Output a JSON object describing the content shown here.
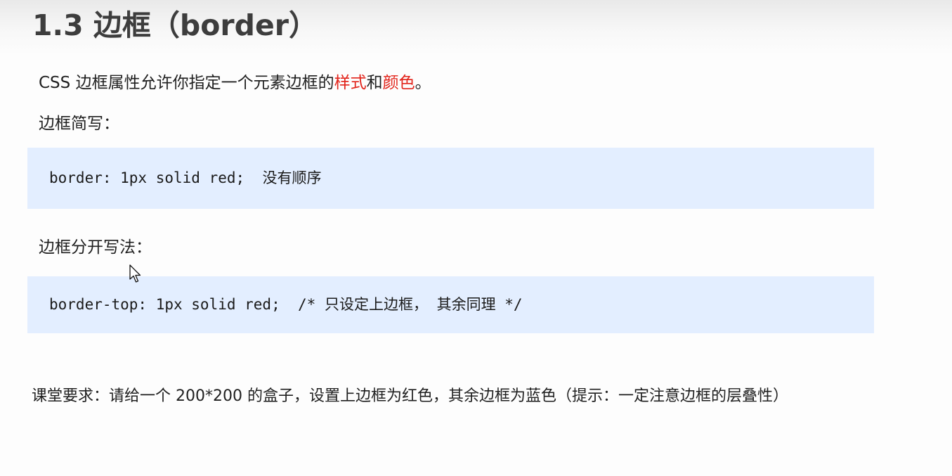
{
  "slide": {
    "title": "1.3 边框（border）"
  },
  "intro": {
    "before": "CSS 边框属性允许你指定一个元素边框的",
    "style_word": "样式",
    "and_word": "和",
    "color_word": "颜色",
    "end_punct": "。"
  },
  "shorthand": {
    "label": "边框简写：",
    "code": "border: 1px solid red;",
    "note": "没有顺序"
  },
  "separate": {
    "label": "边框分开写法：",
    "code": "border-top: 1px solid red;",
    "comment": "/* 只设定上边框， 其余同理 */"
  },
  "assignment": {
    "text": "课堂要求：请给一个 200*200 的盒子，设置上边框为红色，其余边框为蓝色（提示：一定注意边框的层叠性）"
  },
  "colors": {
    "highlight": "#e2231a",
    "code_background": "#e3eeff",
    "title": "#3d3d3d"
  },
  "icons": {
    "cursor": "mouse-pointer-icon"
  }
}
